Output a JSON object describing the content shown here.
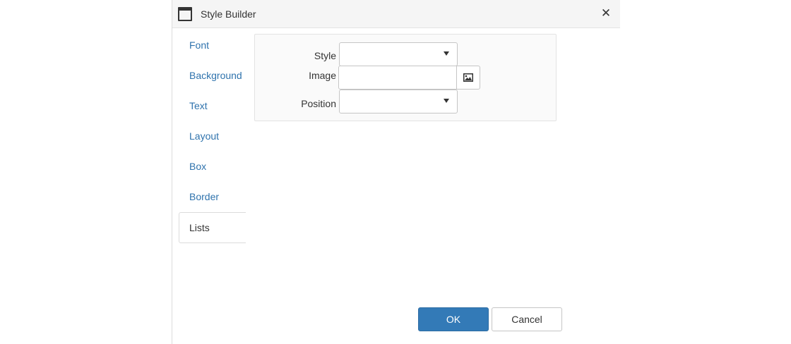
{
  "dialog": {
    "title": "Style Builder",
    "close_icon": "close-icon",
    "window_icon": "window-icon"
  },
  "tabs": [
    {
      "label": "Font",
      "active": false
    },
    {
      "label": "Background",
      "active": false
    },
    {
      "label": "Text",
      "active": false
    },
    {
      "label": "Layout",
      "active": false
    },
    {
      "label": "Box",
      "active": false
    },
    {
      "label": "Border",
      "active": false
    },
    {
      "label": "Lists",
      "active": true
    }
  ],
  "form": {
    "style": {
      "label": "Style",
      "value": ""
    },
    "image": {
      "label": "Image",
      "value": "",
      "placeholder": "",
      "browse_icon": "image-icon"
    },
    "position": {
      "label": "Position",
      "value": ""
    }
  },
  "buttons": {
    "ok": "OK",
    "cancel": "Cancel"
  },
  "colors": {
    "link": "#2f73ad",
    "primary": "#337ab7",
    "titlebar": "#f5f5f5",
    "panel": "#fafafa"
  }
}
